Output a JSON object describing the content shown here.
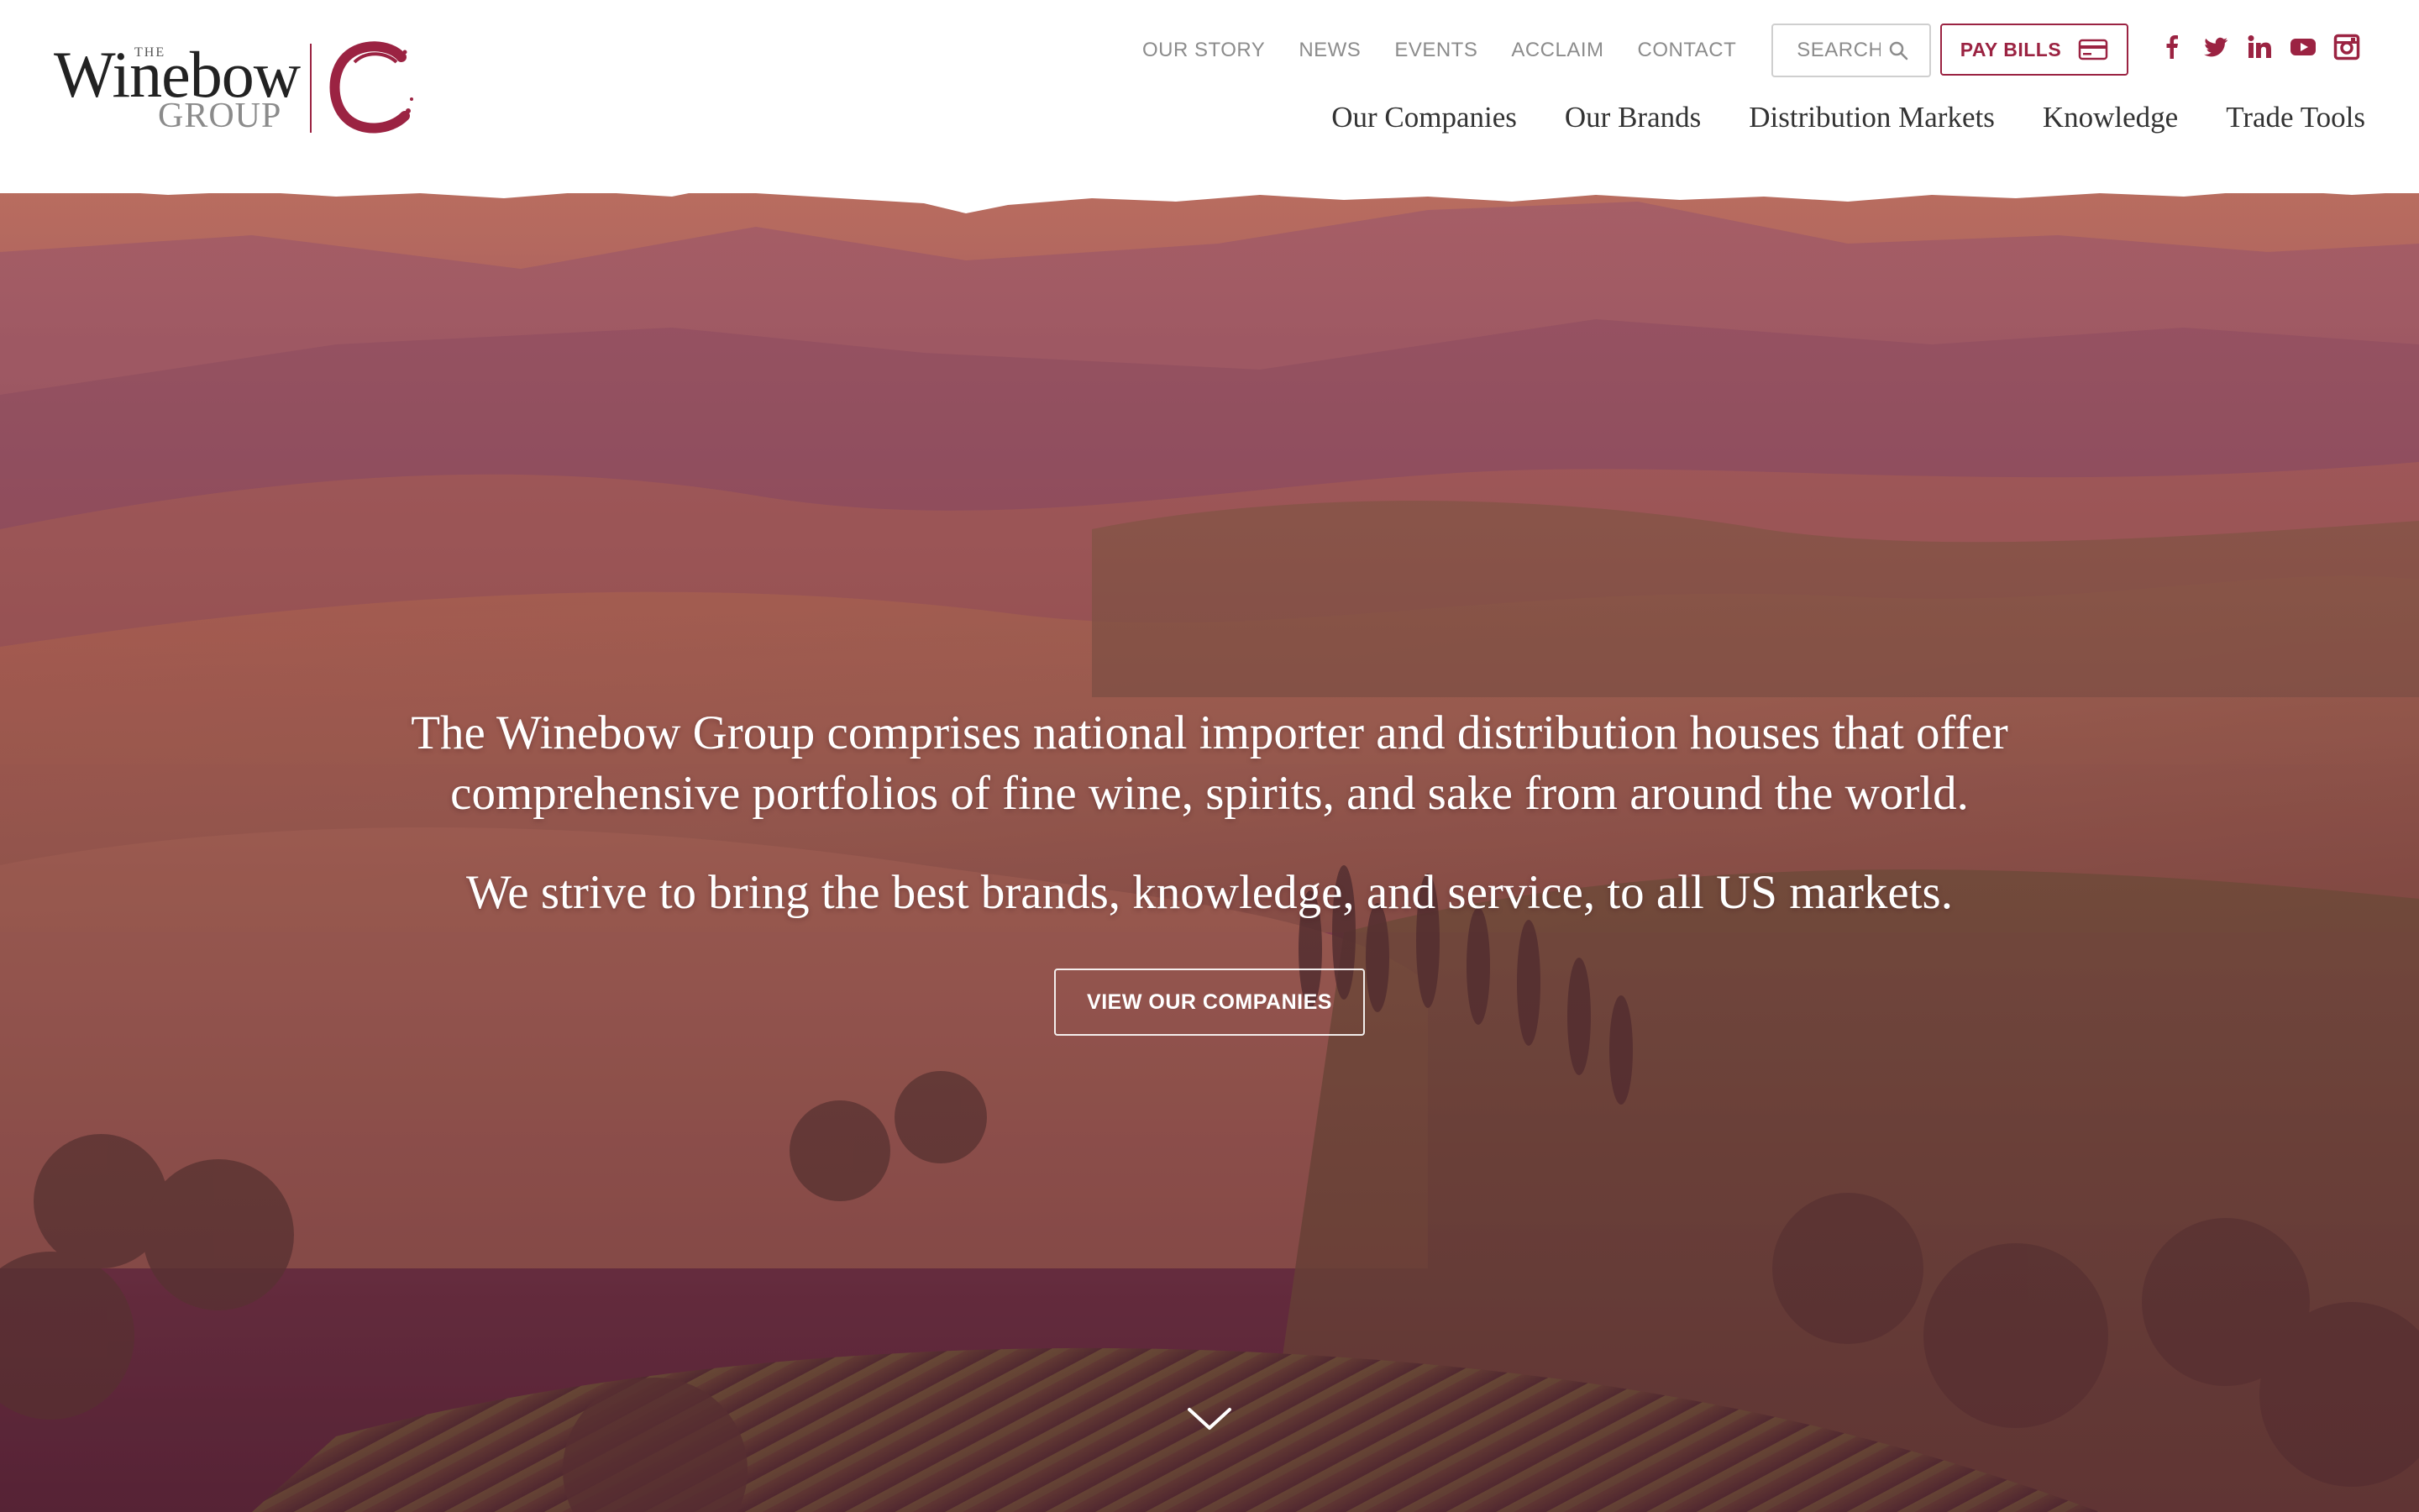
{
  "brand": {
    "the": "THE",
    "name": "Winebow",
    "group": "GROUP",
    "accent_color": "#9b2342"
  },
  "utility_nav": [
    {
      "label": "OUR STORY"
    },
    {
      "label": "NEWS"
    },
    {
      "label": "EVENTS"
    },
    {
      "label": "ACCLAIM"
    },
    {
      "label": "CONTACT"
    }
  ],
  "search": {
    "placeholder": "SEARCH",
    "icon": "search-icon"
  },
  "pay_bills": {
    "label": "PAY BILLS",
    "icon": "credit-card-icon"
  },
  "social": [
    {
      "name": "facebook-icon"
    },
    {
      "name": "twitter-icon"
    },
    {
      "name": "linkedin-icon"
    },
    {
      "name": "youtube-icon"
    },
    {
      "name": "instagram-icon"
    }
  ],
  "main_nav": [
    {
      "label": "Our Companies"
    },
    {
      "label": "Our Brands"
    },
    {
      "label": "Distribution Markets"
    },
    {
      "label": "Knowledge"
    },
    {
      "label": "Trade Tools"
    }
  ],
  "hero": {
    "line1": "The Winebow Group comprises national importer and distribution houses that offer",
    "line2": "comprehensive portfolios of fine wine, spirits, and sake from around the world.",
    "line3": "We strive to bring the best brands, knowledge, and service, to all US markets.",
    "cta_label": "VIEW OUR COMPANIES",
    "scroll_icon": "chevron-down-icon"
  }
}
